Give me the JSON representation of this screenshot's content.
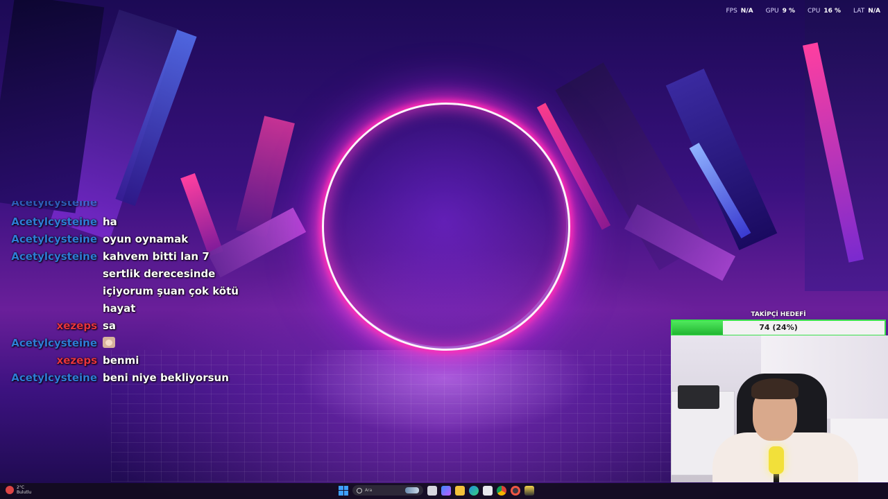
{
  "stats": [
    {
      "label": "FPS",
      "value": "N/A"
    },
    {
      "label": "GPU",
      "value": "9 %"
    },
    {
      "label": "CPU",
      "value": "16 %"
    },
    {
      "label": "LAT",
      "value": "N/A"
    }
  ],
  "chat": {
    "partial_user": "Acetylcysteine",
    "messages": [
      {
        "user": "Acetylcysteine",
        "text": "ha"
      },
      {
        "user": "Acetylcysteine",
        "text": "oyun oynamak"
      },
      {
        "user": "Acetylcysteine",
        "text": "kahvem bitti lan 7 sertlik derecesinde içiyorum şuan çok kötü hayat"
      },
      {
        "user": "xezeps",
        "text": "sa"
      },
      {
        "user": "Acetylcysteine",
        "text": "",
        "emote": "cat-emote"
      },
      {
        "user": "xezeps",
        "text": "benmi"
      },
      {
        "user": "Acetylcysteine",
        "text": "beni niye bekliyorsun"
      }
    ]
  },
  "goal": {
    "title": "TAKİPÇİ HEDEFİ",
    "label": "74 (24%)",
    "progress_fraction": 0.24
  },
  "taskbar": {
    "weather_temp": "2°C",
    "weather_desc": "Bulutlu",
    "search_placeholder": "Ara",
    "apps": [
      "start-icon",
      "task-view-icon",
      "copilot-icon",
      "file-explorer-icon",
      "edge-icon",
      "store-icon",
      "chrome-icon",
      "obs-icon",
      "app-icon"
    ]
  },
  "colors": {
    "user_blue": "#2f7cd6",
    "user_red": "#e7343e",
    "goal_green": "#39e14a",
    "ring": "#ff2cb5"
  }
}
